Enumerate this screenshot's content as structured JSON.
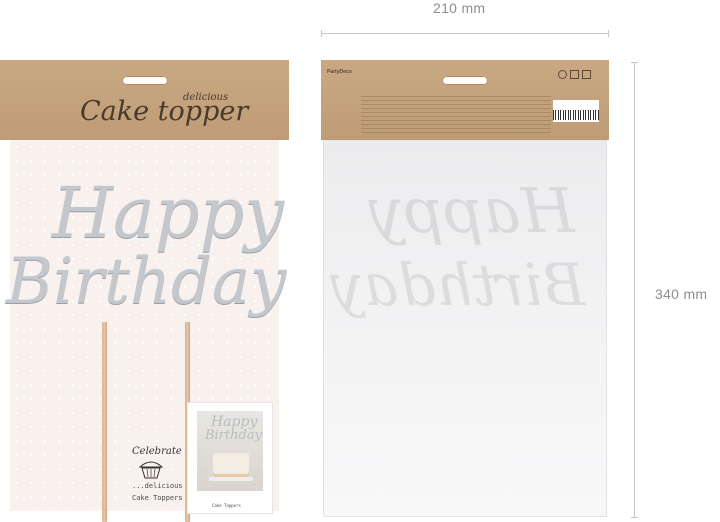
{
  "dimensions": {
    "width_label": "210 mm",
    "height_label": "340 mm"
  },
  "front_package": {
    "header_title": "Cake topper",
    "header_tagline": "delicious",
    "topper_line1": "Happy",
    "topper_line2": "Birthday",
    "badge_top": "Celebrate",
    "badge_bottom": "...delicious",
    "badge_caption": "Cake Toppers",
    "photo_line1": "Happy",
    "photo_line2": "Birthday",
    "photo_caption": "Cake Toppers"
  },
  "back_package": {
    "brand": "PartyDeco",
    "ghost_line1": "Happy",
    "ghost_line2": "Birthday"
  },
  "colors": {
    "kraft": "#c6a47f",
    "topper_silver": "#c4c8cc",
    "dimension_line": "#c8c8c8"
  }
}
